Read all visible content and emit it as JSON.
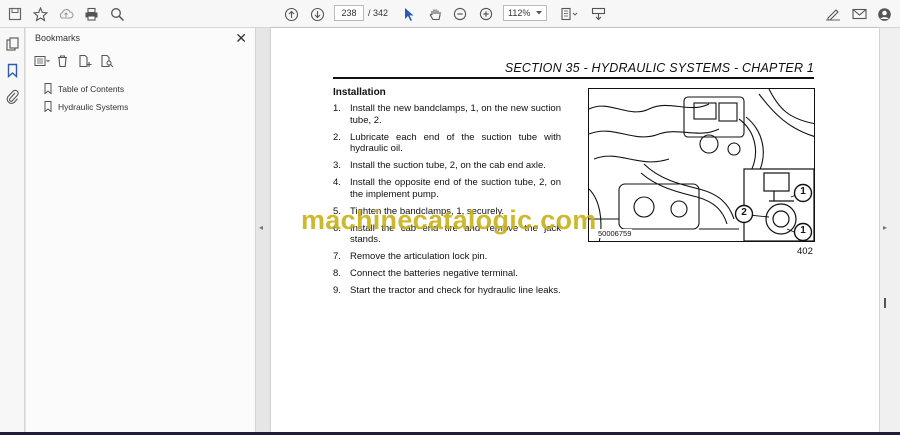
{
  "toolbar": {
    "current_page": "238",
    "page_separator": "/",
    "total_pages": "342",
    "zoom": "112%"
  },
  "bookmarks": {
    "title": "Bookmarks",
    "close": "✕",
    "items": [
      {
        "label": "Table of Contents"
      },
      {
        "label": "Hydraulic Systems"
      }
    ]
  },
  "document": {
    "header": "SECTION 35 - HYDRAULIC SYSTEMS - CHAPTER 1",
    "instructions_title": "Installation",
    "steps": [
      {
        "num": "1.",
        "text": "Install the new bandclamps, 1, on the new suction tube, 2."
      },
      {
        "num": "2.",
        "text": "Lubricate each end of the suction tube with hydraulic oil."
      },
      {
        "num": "3.",
        "text": "Install the suction tube, 2, on the cab end axle."
      },
      {
        "num": "4.",
        "text": "Install the opposite end of the suction tube, 2, on the implement pump."
      },
      {
        "num": "5.",
        "text": "Tighten the bandclamps, 1, securely."
      },
      {
        "num": "6.",
        "text": "Install the cab end tire and remove the jack stands."
      },
      {
        "num": "7.",
        "text": "Remove the articulation lock pin."
      },
      {
        "num": "8.",
        "text": "Connect the batteries negative terminal."
      },
      {
        "num": "9.",
        "text": "Start the tractor and check for hydraulic line leaks."
      }
    ],
    "figure": {
      "code": "50006759",
      "number": "402",
      "callout_1": "1",
      "callout_2": "2"
    },
    "watermark": "machinecatalogic.com"
  },
  "colors": {
    "watermark": "#c8b21a",
    "accent_blue": "#2a5db0"
  }
}
